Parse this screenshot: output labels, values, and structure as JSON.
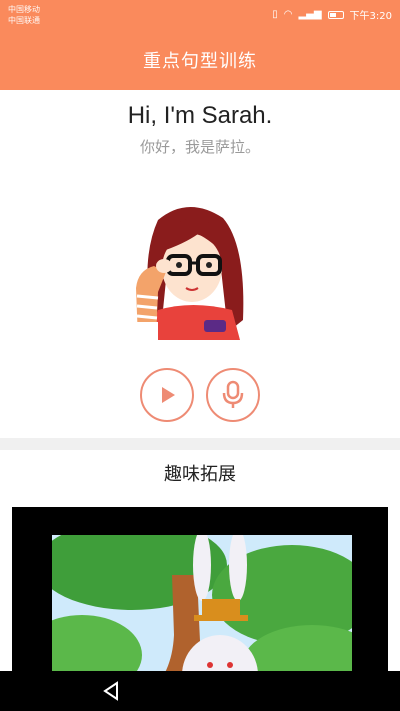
{
  "status_bar": {
    "carrier_line1": "中国移动",
    "carrier_line2": "中国联通",
    "time": "下午3:20"
  },
  "header": {
    "title": "重点句型训练"
  },
  "sentence": {
    "english": "Hi, I'm Sarah.",
    "chinese": "你好，我是萨拉。"
  },
  "controls": {
    "play_icon": "play-icon",
    "mic_icon": "microphone-icon"
  },
  "extension": {
    "title": "趣味拓展"
  },
  "colors": {
    "primary": "#fa8a5c",
    "button_outline": "#ee8b74"
  },
  "nav": {
    "back_icon": "back-triangle-icon"
  }
}
